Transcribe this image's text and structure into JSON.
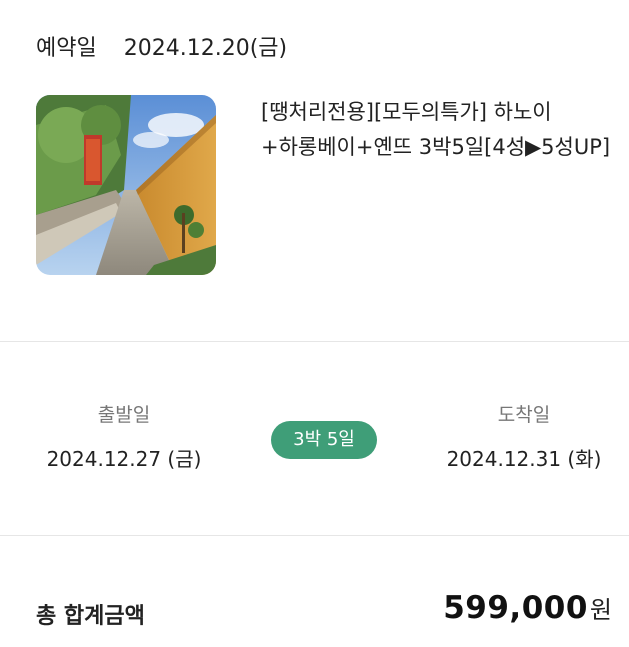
{
  "booking": {
    "label": "예약일",
    "date": "2024.12.20(금)"
  },
  "product": {
    "title": "[땡처리전용][모두의특가] 하노이+하롱베이+옌뜨 3박5일[4성▶5성UP]",
    "thumbnail_icon": "temple-corridor-photo"
  },
  "schedule": {
    "departure_label": "출발일",
    "departure_date": "2024.12.27 (금)",
    "duration": "3박 5일",
    "arrival_label": "도착일",
    "arrival_date": "2024.12.31 (화)"
  },
  "total": {
    "label": "총 합계금액",
    "amount": "599,000",
    "currency": "원"
  },
  "colors": {
    "badge": "#3f9e78",
    "divider": "#e6e6e6",
    "caption": "#777777"
  }
}
